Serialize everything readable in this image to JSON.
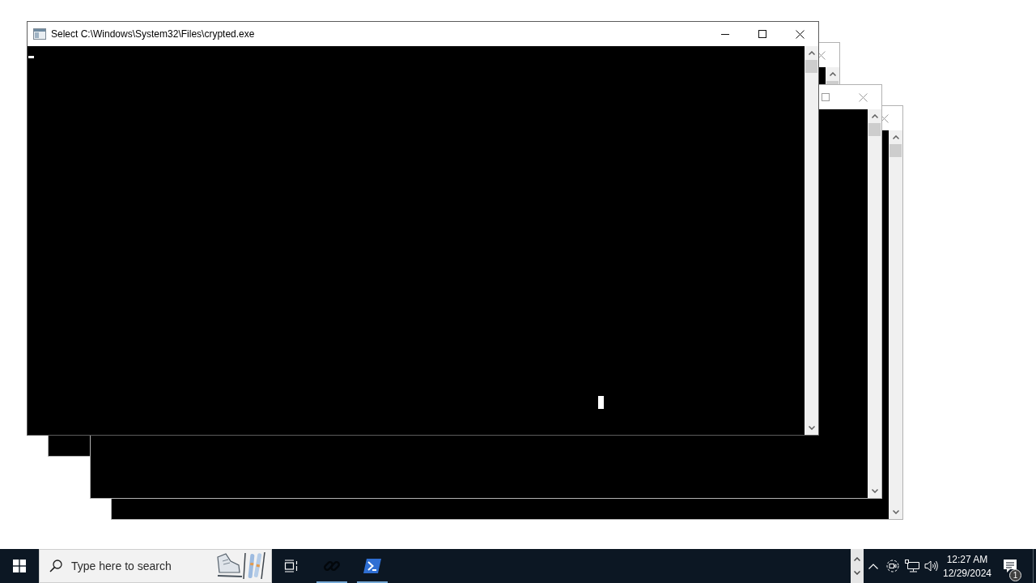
{
  "console_windows": [
    {
      "title": "Select C:\\Windows\\System32\\Files\\crypted.exe",
      "active": true
    },
    {
      "active": false
    },
    {
      "active": false
    },
    {
      "active": false
    }
  ],
  "taskbar": {
    "search": {
      "placeholder": "Type here to search"
    },
    "apps": [
      {
        "kind": "link",
        "running": true
      },
      {
        "kind": "terminal",
        "running": true
      }
    ],
    "clock": {
      "time": "12:27 AM",
      "date": "12/29/2024"
    },
    "notifications": {
      "count": "1"
    }
  }
}
